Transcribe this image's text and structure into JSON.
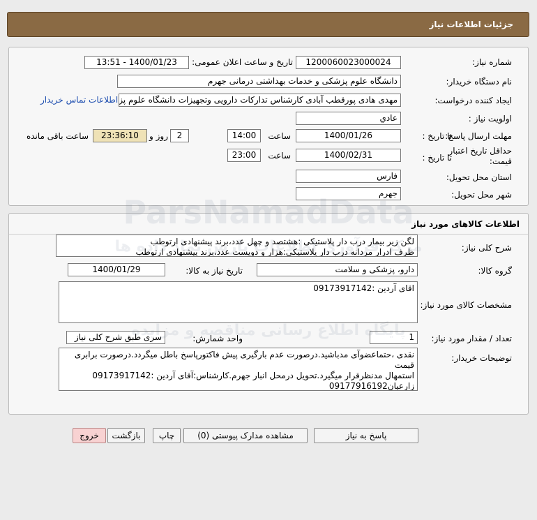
{
  "header": {
    "title": "جزئیات اطلاعات نیاز"
  },
  "need": {
    "number_label": "شماره نیاز:",
    "number": "1200060023000024",
    "announce_label": "تاریخ و ساعت اعلان عمومی:",
    "announce": "1400/01/23 - 13:51",
    "buyer_label": "نام دستگاه خریدار:",
    "buyer": "دانشگاه علوم پزشکی و خدمات بهداشتی درمانی جهرم",
    "creator_label": "ایجاد کننده درخواست:",
    "creator": "مهدی هادی پورقطب آبادی کارشناس تدارکات دارویی وتجهیزات دانشگاه علوم پزشکی",
    "contact_link": "اطلاعات تماس خریدار",
    "priority_label": "اولویت نیاز :",
    "priority": "عادي",
    "deadline_label": "مهلت ارسال پاسخ:",
    "until_label": "تا تاریخ :",
    "deadline_date": "1400/01/26",
    "time_label": "ساعت",
    "deadline_time": "14:00",
    "days": "2",
    "days_label": "روز و",
    "remaining": "23:36:10",
    "remaining_label": "ساعت باقی مانده",
    "validity_label_1": "حداقل تاریخ اعتبار",
    "validity_label_2": "قیمت:",
    "validity_until_label": "تا تاریخ :",
    "validity_date": "1400/02/31",
    "validity_time_label": "ساعت",
    "validity_time": "23:00",
    "province_label": "استان محل تحویل:",
    "province": "فارس",
    "city_label": "شهر محل تحویل:",
    "city": "جهرم"
  },
  "goods": {
    "section_title": "اطلاعات کالاهای مورد نیاز",
    "desc_label": "شرح کلی نیاز:",
    "desc_line1": "لگن زیر بیمار درب دار پلاستیکی       :هشتصد و چهل عدد،برند پیشنهادی ارتوطب",
    "desc_line2": "ظرف ادرار مردانه درب دار پلاستیکی:هزار و دویست عدد،برند پیشنهادی ارتوطب",
    "group_label": "گروه کالا:",
    "group": "دارو، پزشکی و سلامت",
    "need_date_label": "تاریخ نیاز به کالا:",
    "need_date": "1400/01/29",
    "spec_label": "مشخصات کالای مورد نیاز:",
    "spec": "اقای آردین :09173917142",
    "qty_label": "تعداد / مقدار مورد نیاز:",
    "qty": "1",
    "unit_label": "واحد شمارش:",
    "unit": "سری طبق شرح کلی نیاز",
    "notes_label": "توضیحات خریدار:",
    "notes_line1": "نقدی ،حتماعضوآی مدباشید.درصورت عدم بارگیری پیش فاکتورپاسخ باطل میگردد.درصورت برابری قیمت",
    "notes_line2": "استمهال مدنظرقرار میگیرد.تحویل درمحل انبار جهرم.کارشناس:آقای آردین :09173917142",
    "notes_line3": "زارعیان09177916192"
  },
  "watermark": {
    "line1": "ParsNamadData",
    "line2": "مرکز فرآوری اطلاعات پارس نماد داده ها",
    "line3": "پایگاه اطلاع رسانی مناقصه و مزایده"
  },
  "actions": {
    "reply": "پاسخ به نیاز",
    "attachments": "مشاهده مدارک پیوستی (0)",
    "print": "چاپ",
    "back": "بازگشت",
    "exit": "خروج"
  }
}
